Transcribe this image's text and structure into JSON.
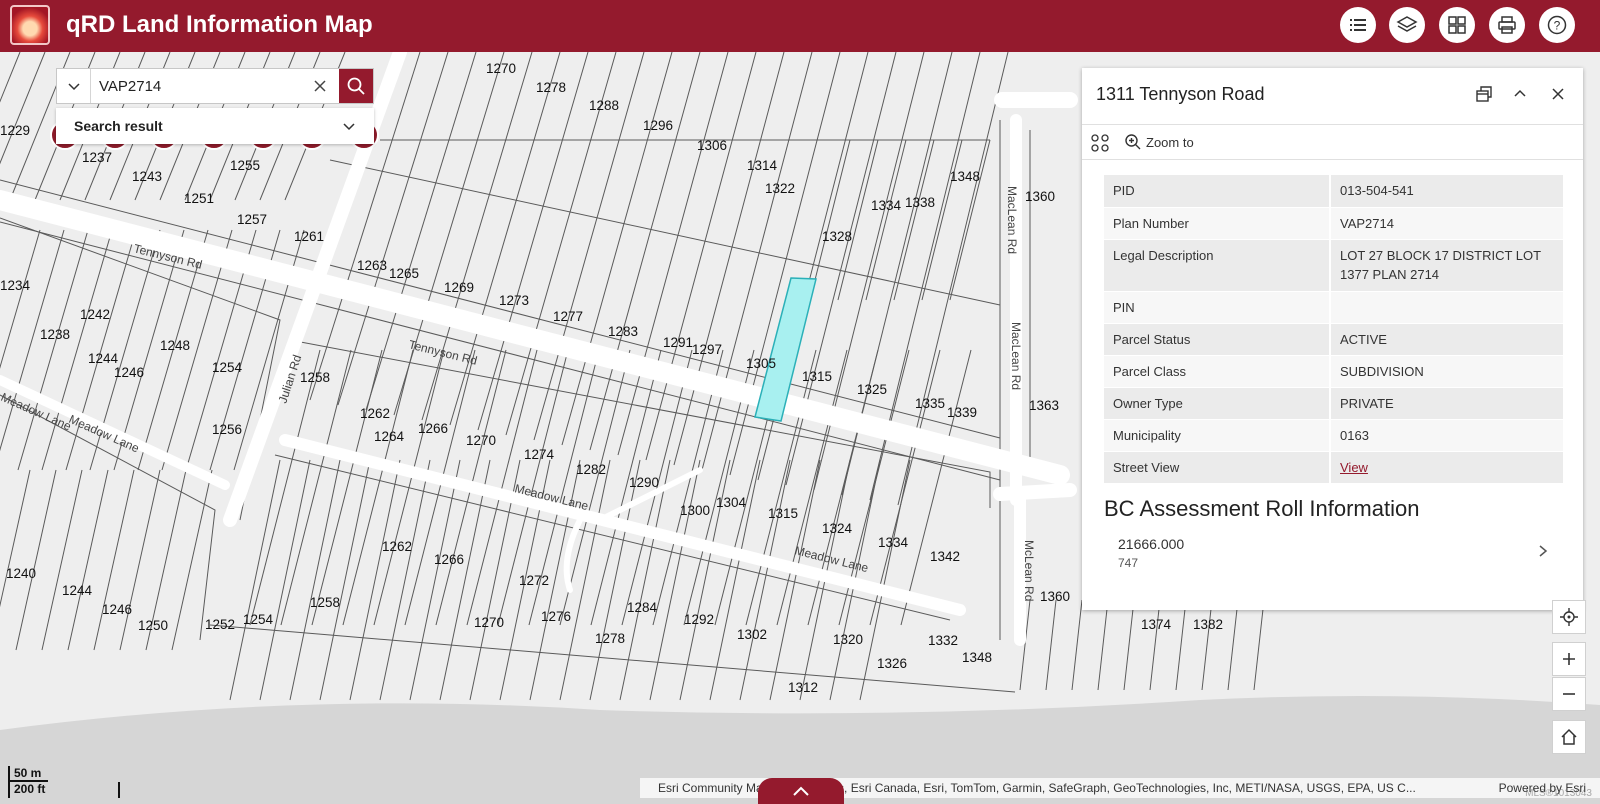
{
  "app": {
    "title": "qRD Land Information Map"
  },
  "header_buttons": [
    {
      "name": "list-icon"
    },
    {
      "name": "layers-icon"
    },
    {
      "name": "basemap-gallery-icon"
    },
    {
      "name": "print-icon"
    },
    {
      "name": "help-icon"
    }
  ],
  "search": {
    "value": "VAP2714",
    "result_label": "Search result"
  },
  "popup": {
    "title": "1311 Tennyson Road",
    "zoom_label": "Zoom to",
    "attributes": [
      {
        "key": "PID",
        "value": "013-504-541"
      },
      {
        "key": "Plan Number",
        "value": "VAP2714"
      },
      {
        "key": "Legal Description",
        "value": "LOT 27 BLOCK 17 DISTRICT LOT 1377 PLAN 2714"
      },
      {
        "key": "PIN",
        "value": ""
      },
      {
        "key": "Parcel Status",
        "value": "ACTIVE"
      },
      {
        "key": "Parcel Class",
        "value": "SUBDIVISION"
      },
      {
        "key": "Owner Type",
        "value": "PRIVATE"
      },
      {
        "key": "Municipality",
        "value": "0163"
      },
      {
        "key": "Street View",
        "value": "View"
      }
    ],
    "bc_title": "BC Assessment Roll Information",
    "bc_value1": "21666.000",
    "bc_value2": "747"
  },
  "map": {
    "streets": [
      "Tennyson Rd",
      "Tennyson Rd",
      "Meadow Lane",
      "Meadow Lane",
      "Meadow Lane",
      "Meadow Lane",
      "Julian Rd",
      "MacLean Rd",
      "MacLean Rd",
      "McLean Rd"
    ],
    "lot_numbers": [
      "1270",
      "1278",
      "1288",
      "1296",
      "1306",
      "1314",
      "1322",
      "1328",
      "1334",
      "1338",
      "1348",
      "1360",
      "1229",
      "1237",
      "1243",
      "1251",
      "1255",
      "1257",
      "1261",
      "1234",
      "1242",
      "1238",
      "1244",
      "1246",
      "1248",
      "1254",
      "1263",
      "1265",
      "1269",
      "1273",
      "1277",
      "1283",
      "1291",
      "1297",
      "1305",
      "1315",
      "1325",
      "1335",
      "1339",
      "1363",
      "1258",
      "1262",
      "1264",
      "1266",
      "1270",
      "1274",
      "1282",
      "1290",
      "1300",
      "1304",
      "1315",
      "1324",
      "1334",
      "1342",
      "1256",
      "1262",
      "1266",
      "1272",
      "1276",
      "1284",
      "1292",
      "1302",
      "1320",
      "1326",
      "1332",
      "1348",
      "1312",
      "1240",
      "1244",
      "1246",
      "1250",
      "1252",
      "1254",
      "1258",
      "1270",
      "1278",
      "1360",
      "1374",
      "1382"
    ],
    "highlight_color": "#a8f0f0",
    "accent_color": "#941a2d"
  },
  "scale": {
    "metric": "50 m",
    "imperial": "200 ft"
  },
  "attribution": {
    "text": "Esri Community Maps Contributors, Esri Canada, Esri, TomTom, Garmin, SafeGraph, GeoTechnologies, Inc, METI/NASA, USGS, EPA, US C...",
    "powered": "Powered by Esri"
  },
  "watermark": "MLS®1013043"
}
